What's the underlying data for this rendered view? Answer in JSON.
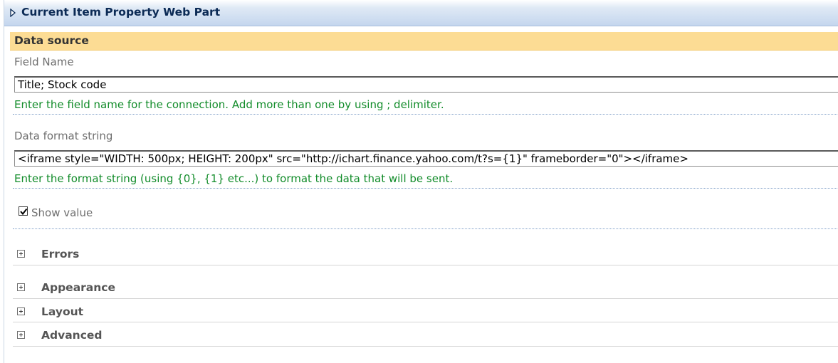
{
  "header": {
    "title": "Current Item Property Web Part"
  },
  "data_source": {
    "title": "Data source",
    "field_name": {
      "label": "Field Name",
      "value": "Title; Stock code",
      "hint": "Enter the field name for the connection. Add more than one by using ; delimiter."
    },
    "format_string": {
      "label": "Data format string",
      "value": "<iframe style=\"WIDTH: 500px; HEIGHT: 200px\" src=\"http://ichart.finance.yahoo.com/t?s={1}\" frameborder=\"0\"></iframe>",
      "hint": "Enter the format string (using {0}, {1} etc...) to format the data that will be sent."
    },
    "show_value": {
      "label": "Show value",
      "checked": true
    }
  },
  "groups": [
    {
      "label": "Errors"
    },
    {
      "label": "Appearance"
    },
    {
      "label": "Layout"
    },
    {
      "label": "Advanced"
    }
  ],
  "icons": {
    "collapse": "collapse-triangle-icon",
    "expand": "plus-box-icon",
    "check": "checkmark-icon"
  },
  "colors": {
    "section_header": "#fcdc94",
    "hint_text": "#128c2a",
    "title_text": "#0b2a55"
  }
}
